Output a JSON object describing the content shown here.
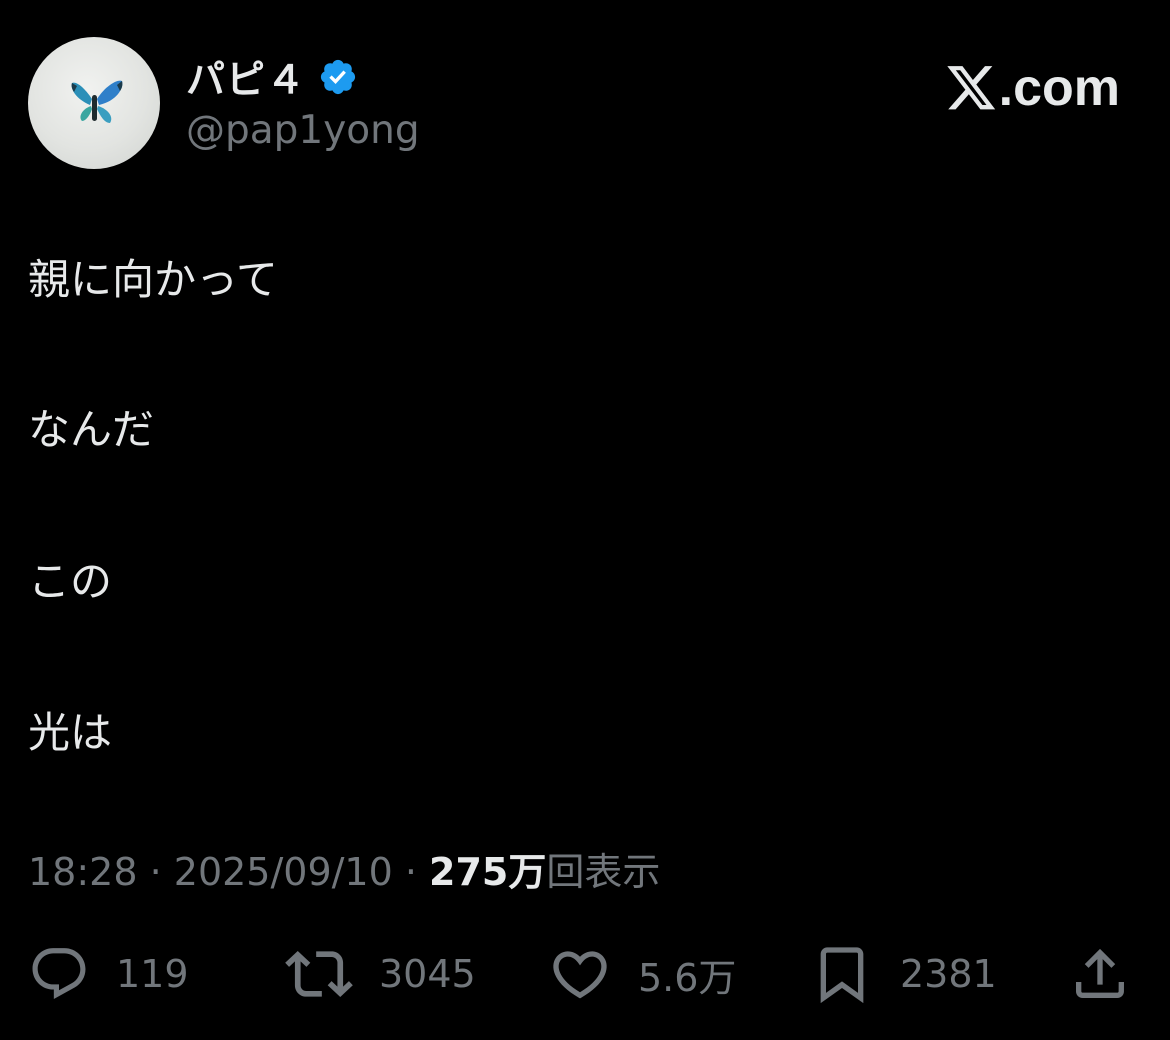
{
  "author": {
    "display_name": "パピ４",
    "handle": "@pap1yong",
    "verified": true,
    "avatar_icon": "butterfly-icon"
  },
  "brand": {
    "icon": "x-logo-icon",
    "text": ".com"
  },
  "tweet": {
    "lines": [
      "親に向かって",
      "なんだ",
      "この",
      "光は"
    ]
  },
  "meta": {
    "time": "18:28",
    "separator": " · ",
    "date": "2025/09/10",
    "views_count": "275万",
    "views_label": "回表示"
  },
  "actions": {
    "reply": {
      "icon": "reply-icon",
      "count": "119"
    },
    "retweet": {
      "icon": "retweet-icon",
      "count": "3045"
    },
    "like": {
      "icon": "heart-icon",
      "count": "5.6万"
    },
    "bookmark": {
      "icon": "bookmark-icon",
      "count": "2381"
    },
    "share": {
      "icon": "share-icon"
    }
  },
  "colors": {
    "background": "#000000",
    "text_primary": "#e7e9ea",
    "text_secondary": "#71767b",
    "verified_badge": "#1d9bf0"
  }
}
